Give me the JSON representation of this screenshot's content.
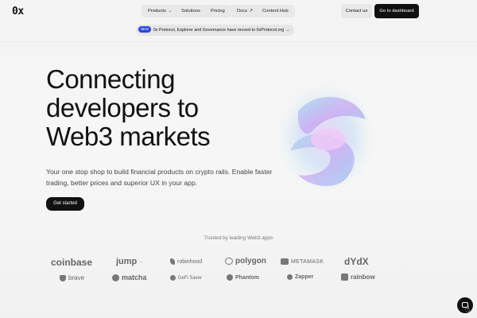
{
  "nav": {
    "logo": "0x",
    "items": [
      {
        "label": "Products",
        "chevron": "⌄"
      },
      {
        "label": "Solutions"
      },
      {
        "label": "Pricing"
      },
      {
        "label": "Docs",
        "external": "↗"
      },
      {
        "label": "Content Hub"
      }
    ],
    "contact_label": "Contact us",
    "dashboard_label": "Go to dashboard"
  },
  "announcement": {
    "badge": "NEW",
    "text": "0x Protocol, Explorer and Governance have moved to 0xProtocol.org",
    "arrow": "→"
  },
  "hero": {
    "title_lines": [
      "Connecting",
      "developers to",
      "Web3 markets"
    ],
    "subtitle": "Your one stop shop to build financial products on crypto rails. Enable faster trading, better prices and superior UX in your app.",
    "cta_label": "Get started"
  },
  "trusted": {
    "label": "Trusted by leading Web3 apps",
    "logos_row1": [
      "coinbase",
      "jump",
      "robinhood",
      "polygon",
      "METAMASK",
      "dYdX"
    ],
    "logos_row2": [
      "brave",
      "matcha",
      "DeFi Saver",
      "Phantom",
      "Zapper",
      "rainbow"
    ]
  },
  "colors": {
    "badge": "#2b45e6",
    "primary_button": "#111111",
    "pill": "#e8e8e8"
  }
}
